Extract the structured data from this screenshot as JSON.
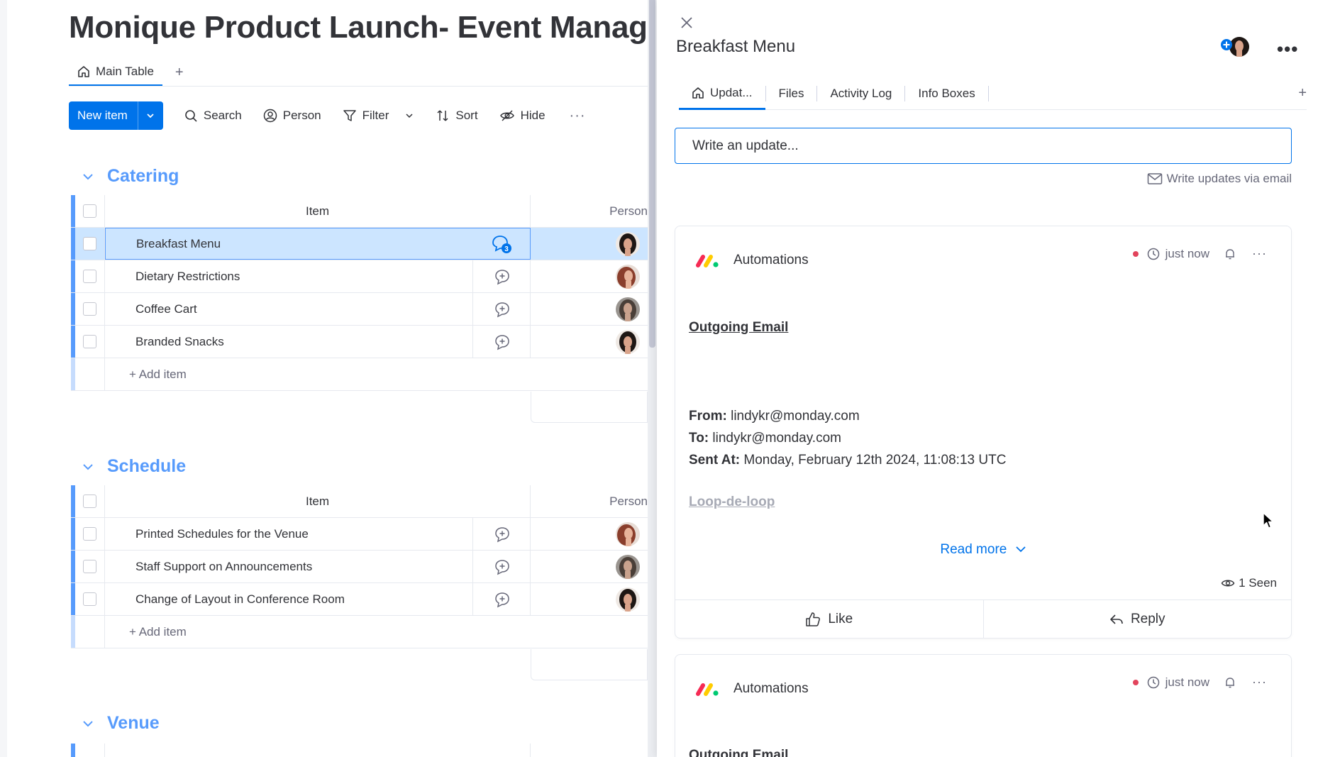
{
  "board": {
    "title": "Monique Product Launch- Event Manage",
    "view_tab": "Main Table",
    "view_add": "+",
    "toolbar": {
      "new_item": "New item",
      "search": "Search",
      "person": "Person",
      "filter": "Filter",
      "sort": "Sort",
      "hide": "Hide",
      "more": "···"
    },
    "groups": [
      {
        "name": "Catering",
        "color": "#579bfc",
        "header_item": "Item",
        "header_person": "Person",
        "items": [
          {
            "name": "Breakfast Menu",
            "updates": "3",
            "selected": true
          },
          {
            "name": "Dietary Restrictions"
          },
          {
            "name": "Coffee Cart"
          },
          {
            "name": "Branded Snacks"
          }
        ],
        "add_item": "+ Add item"
      },
      {
        "name": "Schedule",
        "color": "#579bfc",
        "header_item": "Item",
        "header_person": "Person",
        "items": [
          {
            "name": "Printed Schedules for the Venue"
          },
          {
            "name": "Staff Support on Announcements"
          },
          {
            "name": "Change of Layout in Conference Room"
          }
        ],
        "add_item": "+ Add item"
      },
      {
        "name": "Venue",
        "color": "#579bfc"
      }
    ]
  },
  "panel": {
    "title": "Breakfast Menu",
    "more": "•••",
    "tabs": [
      "Updat...",
      "Files",
      "Activity Log",
      "Info Boxes"
    ],
    "tab_add": "+",
    "input_placeholder": "Write an update...",
    "via_email": "Write updates via email",
    "updates": [
      {
        "author": "Automations",
        "time": "just now",
        "heading": "Outgoing Email",
        "from_label": "From:",
        "from": "lindykr@monday.com",
        "to_label": "To:",
        "to": "lindykr@monday.com",
        "sent_label": "Sent At:",
        "sent": "Monday, February 12th 2024, 11:08:13 UTC",
        "link": "Loop-de-loop",
        "read_more": "Read more",
        "seen": "1 Seen",
        "like": "Like",
        "reply": "Reply"
      },
      {
        "author": "Automations",
        "time": "just now",
        "heading": "Outgoing Email"
      }
    ]
  },
  "colors": {
    "accent": "#0073ea",
    "group": "#579bfc",
    "selected_row": "#cce5ff",
    "status_dot": "#e2445c"
  }
}
